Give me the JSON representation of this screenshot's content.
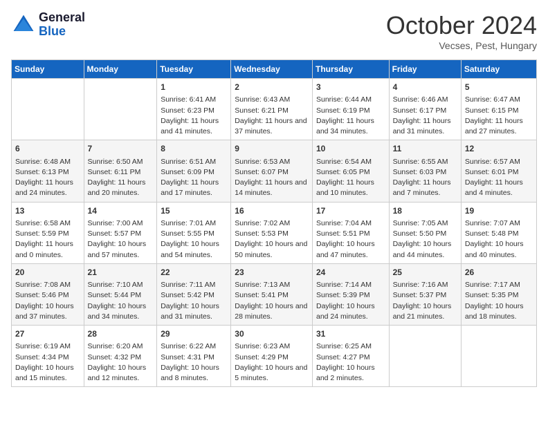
{
  "header": {
    "logo_line1": "General",
    "logo_line2": "Blue",
    "month_title": "October 2024",
    "location": "Vecses, Pest, Hungary"
  },
  "days_of_week": [
    "Sunday",
    "Monday",
    "Tuesday",
    "Wednesday",
    "Thursday",
    "Friday",
    "Saturday"
  ],
  "weeks": [
    [
      {
        "day": "",
        "info": ""
      },
      {
        "day": "",
        "info": ""
      },
      {
        "day": "1",
        "info": "Sunrise: 6:41 AM\nSunset: 6:23 PM\nDaylight: 11 hours and 41 minutes."
      },
      {
        "day": "2",
        "info": "Sunrise: 6:43 AM\nSunset: 6:21 PM\nDaylight: 11 hours and 37 minutes."
      },
      {
        "day": "3",
        "info": "Sunrise: 6:44 AM\nSunset: 6:19 PM\nDaylight: 11 hours and 34 minutes."
      },
      {
        "day": "4",
        "info": "Sunrise: 6:46 AM\nSunset: 6:17 PM\nDaylight: 11 hours and 31 minutes."
      },
      {
        "day": "5",
        "info": "Sunrise: 6:47 AM\nSunset: 6:15 PM\nDaylight: 11 hours and 27 minutes."
      }
    ],
    [
      {
        "day": "6",
        "info": "Sunrise: 6:48 AM\nSunset: 6:13 PM\nDaylight: 11 hours and 24 minutes."
      },
      {
        "day": "7",
        "info": "Sunrise: 6:50 AM\nSunset: 6:11 PM\nDaylight: 11 hours and 20 minutes."
      },
      {
        "day": "8",
        "info": "Sunrise: 6:51 AM\nSunset: 6:09 PM\nDaylight: 11 hours and 17 minutes."
      },
      {
        "day": "9",
        "info": "Sunrise: 6:53 AM\nSunset: 6:07 PM\nDaylight: 11 hours and 14 minutes."
      },
      {
        "day": "10",
        "info": "Sunrise: 6:54 AM\nSunset: 6:05 PM\nDaylight: 11 hours and 10 minutes."
      },
      {
        "day": "11",
        "info": "Sunrise: 6:55 AM\nSunset: 6:03 PM\nDaylight: 11 hours and 7 minutes."
      },
      {
        "day": "12",
        "info": "Sunrise: 6:57 AM\nSunset: 6:01 PM\nDaylight: 11 hours and 4 minutes."
      }
    ],
    [
      {
        "day": "13",
        "info": "Sunrise: 6:58 AM\nSunset: 5:59 PM\nDaylight: 11 hours and 0 minutes."
      },
      {
        "day": "14",
        "info": "Sunrise: 7:00 AM\nSunset: 5:57 PM\nDaylight: 10 hours and 57 minutes."
      },
      {
        "day": "15",
        "info": "Sunrise: 7:01 AM\nSunset: 5:55 PM\nDaylight: 10 hours and 54 minutes."
      },
      {
        "day": "16",
        "info": "Sunrise: 7:02 AM\nSunset: 5:53 PM\nDaylight: 10 hours and 50 minutes."
      },
      {
        "day": "17",
        "info": "Sunrise: 7:04 AM\nSunset: 5:51 PM\nDaylight: 10 hours and 47 minutes."
      },
      {
        "day": "18",
        "info": "Sunrise: 7:05 AM\nSunset: 5:50 PM\nDaylight: 10 hours and 44 minutes."
      },
      {
        "day": "19",
        "info": "Sunrise: 7:07 AM\nSunset: 5:48 PM\nDaylight: 10 hours and 40 minutes."
      }
    ],
    [
      {
        "day": "20",
        "info": "Sunrise: 7:08 AM\nSunset: 5:46 PM\nDaylight: 10 hours and 37 minutes."
      },
      {
        "day": "21",
        "info": "Sunrise: 7:10 AM\nSunset: 5:44 PM\nDaylight: 10 hours and 34 minutes."
      },
      {
        "day": "22",
        "info": "Sunrise: 7:11 AM\nSunset: 5:42 PM\nDaylight: 10 hours and 31 minutes."
      },
      {
        "day": "23",
        "info": "Sunrise: 7:13 AM\nSunset: 5:41 PM\nDaylight: 10 hours and 28 minutes."
      },
      {
        "day": "24",
        "info": "Sunrise: 7:14 AM\nSunset: 5:39 PM\nDaylight: 10 hours and 24 minutes."
      },
      {
        "day": "25",
        "info": "Sunrise: 7:16 AM\nSunset: 5:37 PM\nDaylight: 10 hours and 21 minutes."
      },
      {
        "day": "26",
        "info": "Sunrise: 7:17 AM\nSunset: 5:35 PM\nDaylight: 10 hours and 18 minutes."
      }
    ],
    [
      {
        "day": "27",
        "info": "Sunrise: 6:19 AM\nSunset: 4:34 PM\nDaylight: 10 hours and 15 minutes."
      },
      {
        "day": "28",
        "info": "Sunrise: 6:20 AM\nSunset: 4:32 PM\nDaylight: 10 hours and 12 minutes."
      },
      {
        "day": "29",
        "info": "Sunrise: 6:22 AM\nSunset: 4:31 PM\nDaylight: 10 hours and 8 minutes."
      },
      {
        "day": "30",
        "info": "Sunrise: 6:23 AM\nSunset: 4:29 PM\nDaylight: 10 hours and 5 minutes."
      },
      {
        "day": "31",
        "info": "Sunrise: 6:25 AM\nSunset: 4:27 PM\nDaylight: 10 hours and 2 minutes."
      },
      {
        "day": "",
        "info": ""
      },
      {
        "day": "",
        "info": ""
      }
    ]
  ]
}
